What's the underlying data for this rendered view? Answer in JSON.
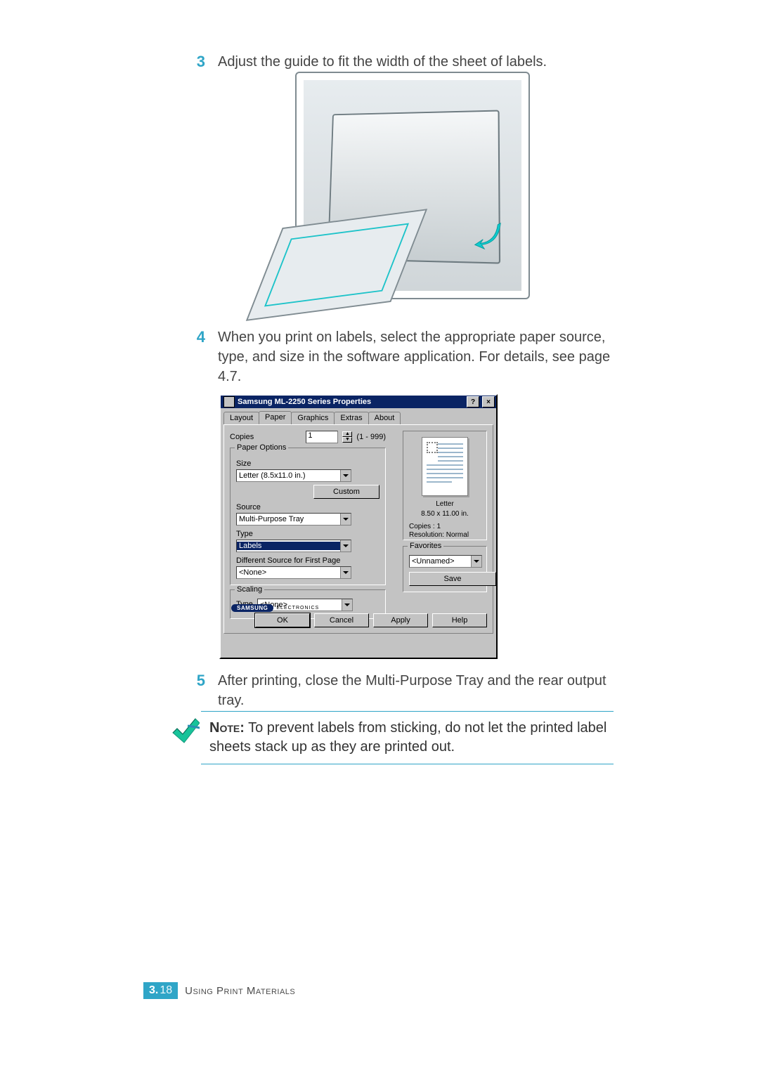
{
  "steps": {
    "s3": {
      "num": "3",
      "text": "Adjust the guide to fit the width of the sheet of labels."
    },
    "s4": {
      "num": "4",
      "text": "When you print on labels, select the appropriate paper source, type, and size in the software application. For details, see page 4.7."
    },
    "s5": {
      "num": "5",
      "text": "After printing, close the Multi-Purpose Tray and the rear output tray."
    }
  },
  "note": {
    "label": "Note:",
    "text": " To prevent labels from sticking, do not let the printed label sheets stack up as they are printed out."
  },
  "footer": {
    "chapter": "3.",
    "page": "18",
    "title": "Using Print Materials"
  },
  "dialog": {
    "title": "Samsung ML-2250 Series Properties",
    "help_btn": "?",
    "close_btn": "×",
    "tabs": {
      "layout": "Layout",
      "paper": "Paper",
      "graphics": "Graphics",
      "extras": "Extras",
      "about": "About"
    },
    "copies": {
      "label": "Copies",
      "value": "1",
      "range": "(1 - 999)"
    },
    "paper_options": {
      "legend": "Paper Options",
      "size_label": "Size",
      "size_value": "Letter (8.5x11.0 in.)",
      "custom_btn": "Custom",
      "source_label": "Source",
      "source_value": "Multi-Purpose Tray",
      "type_label": "Type",
      "type_value": "Labels",
      "diff_label": "Different Source for First Page",
      "diff_value": "<None>"
    },
    "scaling": {
      "legend": "Scaling",
      "type_label": "Type",
      "type_value": "<None>"
    },
    "preview": {
      "paper_name": "Letter",
      "paper_dim": "8.50 x 11.00 in.",
      "copies_line": "Copies : 1",
      "res_line": "Resolution: Normal"
    },
    "favorites": {
      "legend": "Favorites",
      "value": "<Unnamed>",
      "save_btn": "Save"
    },
    "brand": {
      "name": "SAMSUNG",
      "sub": "ELECTRONICS"
    },
    "buttons": {
      "ok": "OK",
      "cancel": "Cancel",
      "apply": "Apply",
      "help": "Help"
    }
  }
}
